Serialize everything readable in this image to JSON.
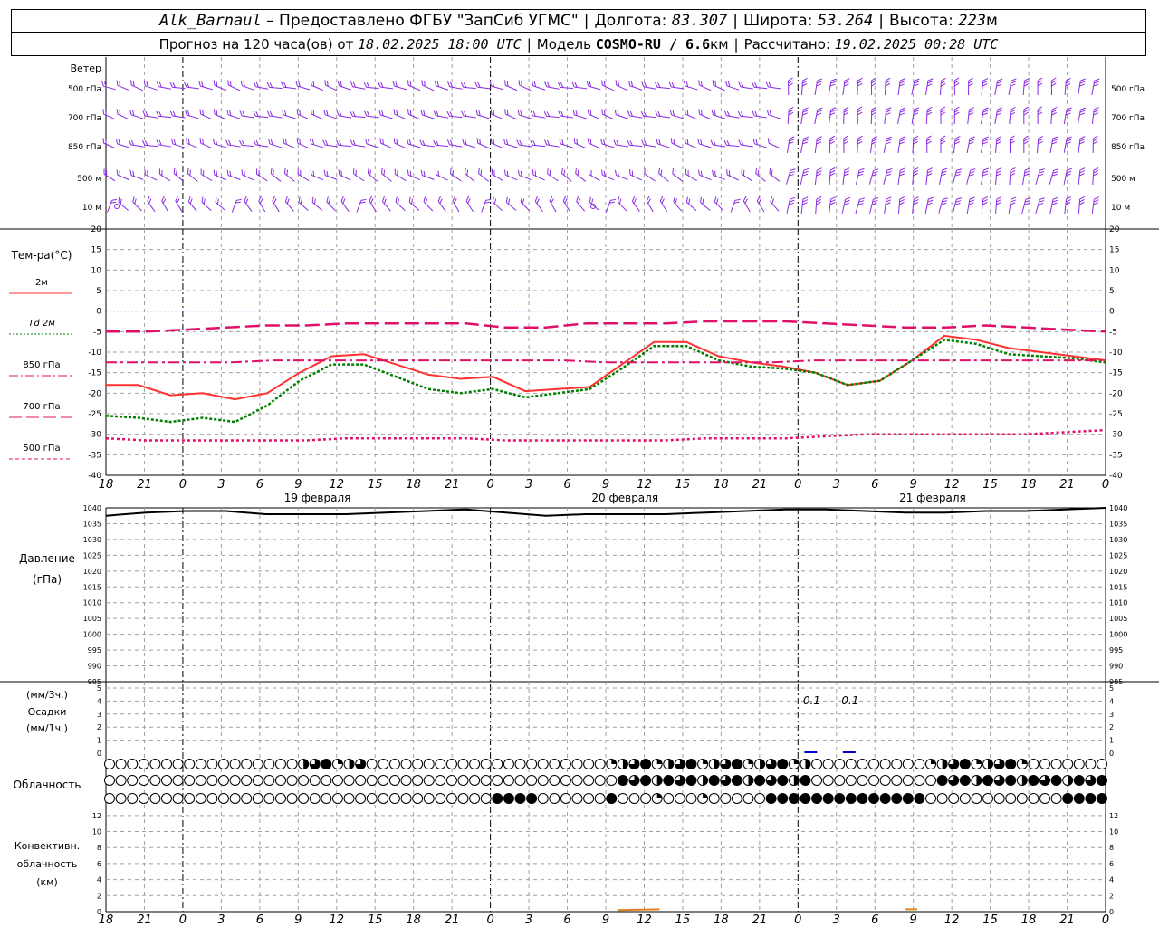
{
  "header": {
    "station": "Alk_Barnaul",
    "provider": "– Предоставлено ФГБУ \"ЗапСиб УГМС\"",
    "lon_label": "Долгота:",
    "lon": "83.307",
    "lat_label": "Широта:",
    "lat": "53.264",
    "alt_label": "Высота:",
    "alt": "223",
    "alt_unit": "м",
    "forecast_prefix": "Прогноз на 120 часа(ов) от",
    "forecast_time": "18.02.2025 18:00 UTC",
    "model_label": "Модель",
    "model": "COSMO-RU / 6.6",
    "model_unit": "км",
    "computed_label": "Рассчитано:",
    "computed_time": "19.02.2025 00:28 UTC"
  },
  "colors": {
    "wind": "#8a2be2",
    "t2m": "#ff3030",
    "td2m": "#008000",
    "t850": "#e0106a",
    "t700": "#e0106a",
    "t500": "#e0106a",
    "zero_line": "#3050ff",
    "pressure": "#000000",
    "precip": "#0000c0",
    "convective": "#e08020",
    "grid": "#a0a0a0"
  },
  "wind_panel": {
    "title": "Ветер",
    "levels": [
      "500 гПа",
      "700 гПа",
      "850 гПа",
      "500 м",
      "10  м"
    ]
  },
  "time_axis": {
    "tick_labels": [
      "18",
      "21",
      "0",
      "3",
      "6",
      "9",
      "12",
      "15",
      "18",
      "21",
      "0",
      "3",
      "6",
      "9",
      "12",
      "15",
      "18",
      "21",
      "0",
      "3",
      "6",
      "9",
      "12",
      "15",
      "18",
      "21",
      "0"
    ],
    "day_labels": [
      "19 февраля",
      "20 февраля",
      "21 февраля"
    ]
  },
  "chart_data": [
    {
      "type": "line",
      "ylabel": "Тем-ра(°С)",
      "ylim": [
        -40,
        20
      ],
      "y_ticks": [
        20,
        15,
        10,
        5,
        0,
        -5,
        -10,
        -15,
        -20,
        -25,
        -30,
        -35,
        -40
      ],
      "x_hours": [
        0,
        3,
        6,
        9,
        12,
        15,
        18,
        21,
        24,
        27,
        30,
        33,
        36,
        39,
        42,
        45,
        48,
        51,
        54,
        57,
        60,
        63,
        66,
        69,
        72,
        75,
        78
      ],
      "legend": [
        {
          "label": "2м",
          "style": "solid"
        },
        {
          "label": "Td 2м",
          "style": "dotted"
        },
        {
          "label": "850 гПа",
          "style": "dash-dot"
        },
        {
          "label": "700 гПа",
          "style": "long-dash"
        },
        {
          "label": "500 гПа",
          "style": "short-dash"
        }
      ],
      "series": [
        {
          "name": "2м",
          "values": [
            -18,
            -18,
            -20.5,
            -20,
            -21.5,
            -20,
            -15,
            -11,
            -10.5,
            -13,
            -15.5,
            -16.5,
            -16,
            -19.5,
            -19,
            -18.5,
            -13,
            -7.5,
            -7.5,
            -11,
            -12.5,
            -13.5,
            -15,
            -18,
            -17,
            -12,
            -6,
            -7,
            -9,
            -10,
            -11,
            -12
          ]
        },
        {
          "name": "Td 2м",
          "values": [
            -25.5,
            -26,
            -27,
            -26,
            -27,
            -23,
            -17,
            -13,
            -13,
            -16,
            -19,
            -20,
            -19,
            -21,
            -20,
            -19,
            -14,
            -8.5,
            -8.5,
            -12,
            -13.5,
            -14,
            -15,
            -18,
            -17,
            -12,
            -7,
            -8,
            -10.5,
            -11,
            -11.5,
            -12.5
          ]
        },
        {
          "name": "850 гПа",
          "values": [
            -12.5,
            -12.5,
            -12.5,
            -12.5,
            -12,
            -12,
            -12,
            -12,
            -12,
            -12,
            -12,
            -12,
            -12.5,
            -12.5,
            -12.5,
            -12.5,
            -12.5,
            -12,
            -12,
            -12,
            -12,
            -12,
            -12,
            -12,
            -12
          ]
        },
        {
          "name": "700 гПа",
          "values": [
            -5,
            -5,
            -4.5,
            -4,
            -3.5,
            -3.5,
            -3,
            -3,
            -3,
            -3,
            -4,
            -4,
            -3,
            -3,
            -3,
            -2.5,
            -2.5,
            -2.5,
            -3,
            -3.5,
            -4,
            -4,
            -3.5,
            -4,
            -4.5,
            -5
          ]
        },
        {
          "name": "500 гПа",
          "values": [
            -31,
            -31.5,
            -31.5,
            -31.5,
            -31.5,
            -31.5,
            -31,
            -31,
            -31,
            -31,
            -31.5,
            -31.5,
            -31.5,
            -31.5,
            -31.5,
            -31,
            -31,
            -31,
            -30.5,
            -30,
            -30,
            -30,
            -30,
            -30,
            -29.5,
            -29
          ]
        }
      ]
    },
    {
      "type": "line",
      "ylabel": "Давление",
      "ylabel2": "(гПа)",
      "ylim": [
        985,
        1040
      ],
      "y_ticks": [
        1040,
        1035,
        1030,
        1025,
        1020,
        1015,
        1010,
        1005,
        1000,
        995,
        990,
        985
      ],
      "series": [
        {
          "name": "Давление",
          "values": [
            1037.5,
            1038.5,
            1039,
            1039,
            1038,
            1038,
            1038,
            1038.5,
            1039,
            1039.5,
            1038.5,
            1037.5,
            1038,
            1038,
            1038,
            1038.5,
            1039,
            1039.5,
            1039.5,
            1039,
            1038.5,
            1038.5,
            1039,
            1039,
            1039.5,
            1040
          ]
        }
      ]
    },
    {
      "type": "bar",
      "ylabel": "(мм/3ч.)",
      "ylabel2": "Осадки",
      "ylabel3": "(мм/1ч.)",
      "ylim": [
        0,
        5
      ],
      "y_ticks": [
        5,
        4,
        3,
        2,
        1,
        0
      ],
      "annotations": [
        {
          "hour": 0.5,
          "text": "0.1"
        },
        {
          "hour": 3.5,
          "text": "0.1"
        }
      ]
    },
    {
      "type": "line",
      "ylabel": "Конвективн.",
      "ylabel2": "облачность",
      "ylabel3": "(км)",
      "ylim": [
        0,
        13
      ],
      "y_ticks": [
        12,
        10,
        8,
        6,
        4,
        2,
        0
      ],
      "series": [
        {
          "name": "Конвективн. облачность",
          "segments": [
            [
              -2.5,
              0.2
            ],
            [
              1.5,
              0.3
            ]
          ]
        }
      ]
    }
  ],
  "cloud_panel": {
    "title": "Облачность"
  }
}
